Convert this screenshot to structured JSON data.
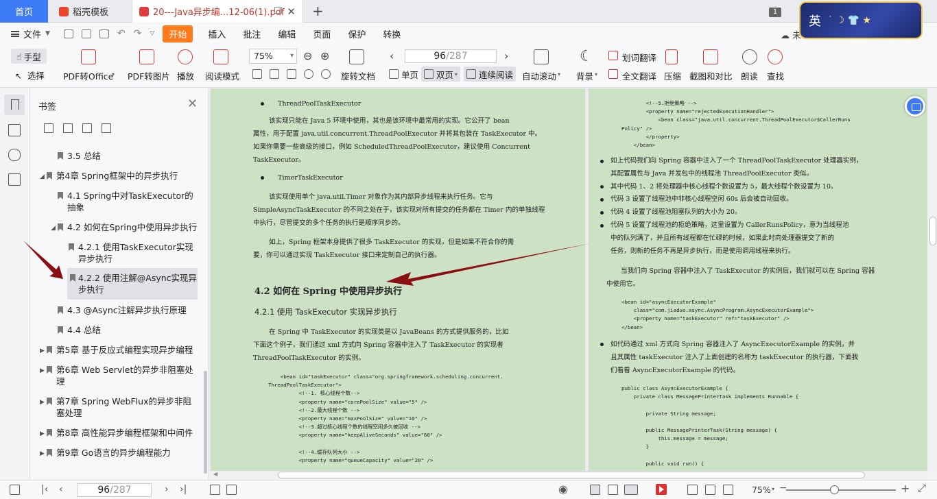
{
  "tabs": {
    "home": "首页",
    "template": "稻壳模板",
    "document": "20---Java异步编...12-06(1).pdf",
    "new_tab": "+",
    "window_count": "1"
  },
  "ime": {
    "lang": "英",
    "symbols": "˙ ☽ 👕 ★"
  },
  "menu": {
    "file": "文件",
    "items": [
      "开始",
      "插入",
      "批注",
      "编辑",
      "页面",
      "保护",
      "转换"
    ],
    "cloud": "未"
  },
  "toolbar": {
    "hand": "手型",
    "select": "选择",
    "pdf_to_office": "PDF转Office",
    "pdf_to_image": "PDF转图片",
    "play": "播放",
    "read_mode": "阅读模式",
    "zoom": "75%",
    "rotate": "旋转文档",
    "page_current": "96",
    "page_total": "/287",
    "single_page": "单页",
    "double_page": "双页",
    "continuous": "连续阅读",
    "auto_scroll": "自动滚动",
    "background": "背景",
    "word_translate": "划词翻译",
    "full_translate": "全文翻译",
    "compress": "压缩",
    "screenshot_compare": "截图和对比",
    "read_aloud": "朗读",
    "find": "查找"
  },
  "bookmarks": {
    "title": "书签",
    "items": [
      {
        "label": "3.5 总结",
        "level": 2
      },
      {
        "label": "第4章 Spring框架中的异步执行",
        "level": 1,
        "expanded": true
      },
      {
        "label": "4.1 Spring中对TaskExecutor的",
        "label2": "抽象",
        "level": 2
      },
      {
        "label": "4.2 如何在Spring中使用异步执行",
        "level": 2,
        "expanded": true
      },
      {
        "label": "4.2.1 使用TaskExecutor实现",
        "label2": "异步执行",
        "level": 3
      },
      {
        "label": "4.2.2 使用注解@Async实现异",
        "label2": "步执行",
        "level": 3,
        "selected": true
      },
      {
        "label": "4.3 @Async注解异步执行原理",
        "level": 2
      },
      {
        "label": "4.4 总结",
        "level": 2
      },
      {
        "label": "第5章 基于反应式编程实现异步编程",
        "level": 1
      },
      {
        "label": "第6章 Web Servlet的异步非阻塞处",
        "label2": "理",
        "level": 1
      },
      {
        "label": "第7章 Spring WebFlux的异步非阻",
        "label2": "塞处理",
        "level": 1
      },
      {
        "label": "第8章 高性能异步编程框架和中间件",
        "level": 1
      },
      {
        "label": "第9章 Go语言的异步编程能力",
        "level": 1
      }
    ]
  },
  "left_page": {
    "bullet1": "ThreadPoolTaskExecutor",
    "p1": [
      "该实现只能在 Java 5 环境中使用，其也是该环境中最常用的实现。它公开了 bean",
      "属性，用于配置 java.util.concurrent.ThreadPoolExecutor 并将其包装在 TaskExecutor 中。",
      "如果你需要一些高级的接口，例如 ScheduledThreadPoolExecutor，建议使用 Concurrent",
      "TaskExecutor。"
    ],
    "bullet2": "TimerTaskExecutor",
    "p2": [
      "该实现使用单个 java.util.Timer 对象作为其内部异步线程来执行任务。它与",
      "SimpleAsyncTaskExecutor 的不同之处在于，该实现对所有提交的任务都在 Timer 内的单独线程",
      "中执行，尽管提交的多个任务的执行是顺序同步的。"
    ],
    "p3": [
      "如上，Spring 框架本身提供了很多 TaskExecutor 的实现，但是如果不符合你的需",
      "要，你可以通过实现 TaskExecutor 接口来定制自己的执行器。"
    ],
    "h2": "4.2   如何在 Spring 中使用异步执行",
    "h3": "4.2.1   使用 TaskExecutor 实现异步执行",
    "p4": [
      "在 Spring 中 TaskExecutor 的实现类是以 JavaBeans 的方式提供服务的，比如",
      "下面这个例子，我们通过 xml 方式向 Spring 容器中注入了 TaskExecutor 的实现者",
      "ThreadPoolTaskExecutor 的实例。"
    ],
    "code": "    <bean id=\"taskExecutor\" class=\"org.springframework.scheduling.concurrent.\nThreadPoolTaskExecutor\">\n          <!--1. 核心线程个数-->\n          <property name=\"corePoolSize\" value=\"5\" />\n          <!--2.最大线程个数 -->\n          <property name=\"maxPoolSize\" value=\"10\" />\n          <!--3.超过核心线程个数的线程空闲多久被回收 -->\n          <property name=\"keepAliveSeconds\" value=\"60\" />\n\n          <!--4.缓存队列大小 -->\n          <property name=\"queueCapacity\" value=\"20\" />"
  },
  "right_page": {
    "code1": "        <!--5.拒绝策略 -->\n        <property name=\"rejectedExecutionHandler\">\n            <bean class=\"java.util.concurrent.ThreadPoolExecutor$CallerRuns\nPolicy\" />\n        </property>\n    </bean>",
    "bullets": [
      [
        "如上代码我们向 Spring 容器中注入了一个 ThreadPoolTaskExecutor 处理器实例，",
        "其配置属性与 Java 并发包中的线程池 ThreadPoolExecutor 类似。"
      ],
      [
        "其中代码 1、2 将处理器中核心线程个数设置为 5，最大线程个数设置为 10。"
      ],
      [
        "代码 3 设置了线程池中非核心线程空闲 60s 后会被自动回收。"
      ],
      [
        "代码 4 设置了线程池阻塞队列的大小为 20。"
      ],
      [
        "代码 5 设置了线程池的拒绝策略，这里设置为 CallerRunsPolicy，意为当线程池",
        "中的队列满了，并且所有线程都在忙碌的时候，如果此时向处理器提交了新的",
        "任务，则新的任务不再是异步执行，而是使用调用线程来执行。"
      ]
    ],
    "p1": [
      "当我们向 Spring 容器中注入了 TaskExecutor 的实例后，我们就可以在 Spring 容器",
      "中使用它。"
    ],
    "code2": "<bean id=\"asyncExecutorExample\"\n    class=\"com.jiaduo.async.AsyncProgram.AsyncExecutorExample\">\n    <property name=\"taskExecutor\" ref=\"taskExecutor\" />\n</bean>",
    "bullet6": [
      "如代码通过 xml 方式向 Spring 容器注入了 AsyncExecutorExample 的实例，并",
      "且其属性 taskExecutor 注入了上面创建的名称为 taskExecutor 的执行器，下面我",
      "们看看 AsyncExecutorExample 的代码。"
    ],
    "code3": "public class AsyncExecutorExample {\n    private class MessagePrinterTask implements Runnable {\n\n        private String message;\n\n        public MessagePrinterTask(String message) {\n            this.message = message;\n        }\n\n        public void run() {"
  },
  "status": {
    "page_current": "96",
    "page_total": "/287",
    "zoom": "75%"
  },
  "colors": {
    "accent": "#3d7af5",
    "start": "#ff7a1a",
    "page_bg": "#cde1c4",
    "arrow": "#8b0e12"
  }
}
